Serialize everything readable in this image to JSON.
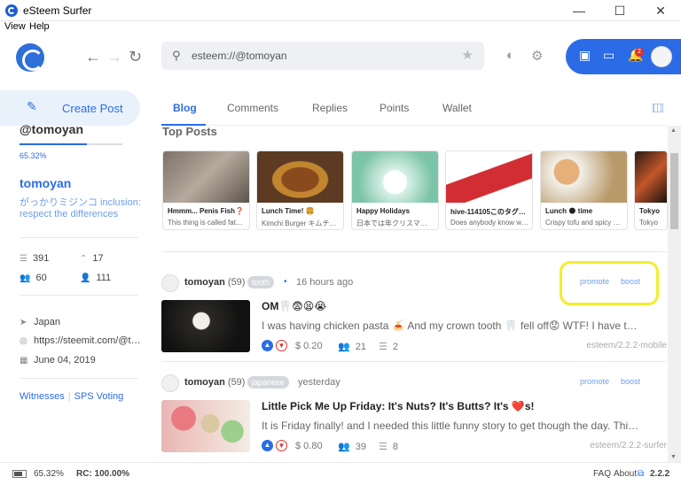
{
  "window": {
    "title": "eSteem Surfer",
    "minimize": "—",
    "maximize": "☐",
    "close": "✕"
  },
  "menu": [
    "View",
    "Help"
  ],
  "header": {
    "address": "esteem://@tomoyan",
    "notification_count": "2",
    "accent": "#2b6ce6"
  },
  "sidebar": {
    "create_post": "Create Post",
    "handle": "@tomoyan",
    "voting_power": "65.32%",
    "voting_power_fraction": 0.6532,
    "name": "tomoyan",
    "about": "がっかりミジンコ inclusion: respect the differences",
    "stats": {
      "posts": "391",
      "following": "17",
      "followers": "60",
      "follows": "111"
    },
    "location": "Japan",
    "website": "https://steemit.com/@t…",
    "joined": "June 04, 2019",
    "links": [
      "Witnesses",
      "SPS Voting"
    ]
  },
  "tabs": [
    "Blog",
    "Comments",
    "Replies",
    "Points",
    "Wallet"
  ],
  "top_posts": {
    "title": "Top Posts",
    "items": [
      {
        "title": "Hmmm... Penis Fish❓",
        "desc": "This thing is called fat…"
      },
      {
        "title": "Lunch Time! 🍔",
        "desc": "Kimchi Burger キムチ…"
      },
      {
        "title": "Happy Holidays",
        "desc": "日本では年クリスマ…"
      },
      {
        "title": "hive-114105このタグ…",
        "desc": "Does anybody know w…"
      },
      {
        "title": "Lunch 🌑 time",
        "desc": "Crispy tofu and spicy …"
      },
      {
        "title": "Tokyo",
        "desc": "Tokyo"
      }
    ]
  },
  "posts": [
    {
      "author": "tomoyan",
      "reputation": "(59)",
      "tag": "tooth",
      "time": "16 hours ago",
      "promote": "promote",
      "boost": "boost",
      "title": "OM🦷😨😫😭",
      "body": "I was having chicken pasta 🍝 And my crown tooth 🦷 fell off😟 WTF! I have t…",
      "payout": "$ 0.20",
      "votes": "21",
      "comments": "2",
      "app": "esteem/2.2.2-mobile"
    },
    {
      "author": "tomoyan",
      "reputation": "(59)",
      "tag": "japanese",
      "time": "yesterday",
      "promote": "promote",
      "boost": "boost",
      "title": "Little Pick Me Up Friday: It's Nuts? It's Butts? It's ❤️s!",
      "body": "It is Friday finally! and I needed this little funny story to get though the day. Thi…",
      "payout": "$ 0.80",
      "votes": "39",
      "comments": "8",
      "app": "esteem/2.2.2-surfer"
    }
  ],
  "status": {
    "voting_power": "65.32%",
    "rc": "RC: 100.00%",
    "faq": "FAQ",
    "about": "About",
    "version": "2.2.2"
  }
}
